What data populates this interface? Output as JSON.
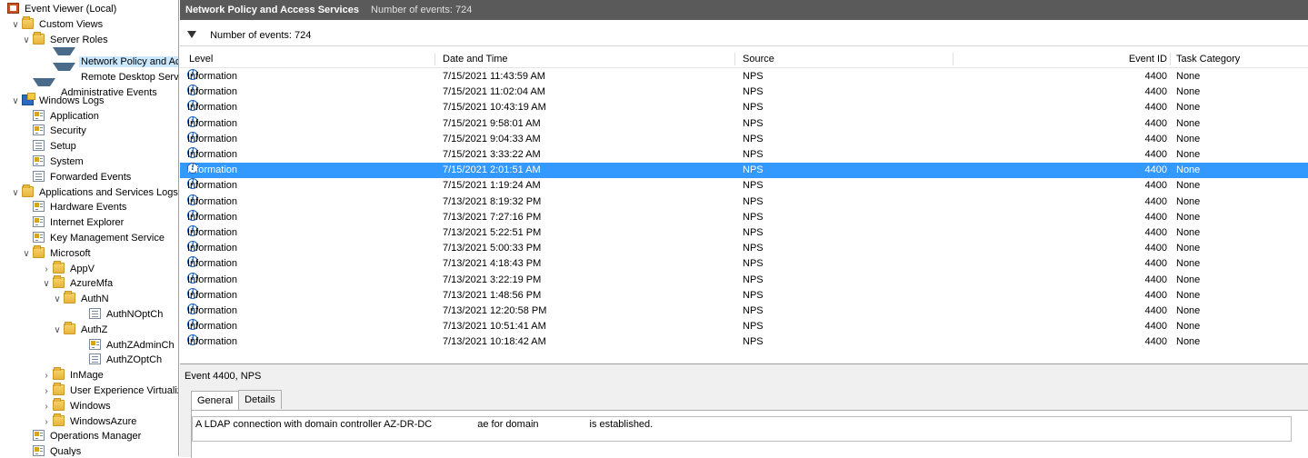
{
  "tree": {
    "items": [
      {
        "label": "Event Viewer (Local)",
        "icon": "event-viewer-icon",
        "level": 0,
        "twist": ""
      },
      {
        "label": "Custom Views",
        "icon": "folder-icon",
        "level": 1,
        "twist": "expanded"
      },
      {
        "label": "Server Roles",
        "icon": "folder-icon",
        "level": 2,
        "twist": "expanded"
      },
      {
        "label": "Network Policy and Access Services",
        "icon": "filter-icon",
        "level": 3,
        "twist": "",
        "selected": true
      },
      {
        "label": "Remote Desktop Services",
        "icon": "filter-icon",
        "level": 3,
        "twist": ""
      },
      {
        "label": "Administrative Events",
        "icon": "filter-icon",
        "level": 2,
        "twist": ""
      },
      {
        "label": "Windows Logs",
        "icon": "windows-logs-icon",
        "level": 1,
        "twist": "expanded"
      },
      {
        "label": "Application",
        "icon": "log-special-icon",
        "level": 2,
        "twist": ""
      },
      {
        "label": "Security",
        "icon": "log-special-icon",
        "level": 2,
        "twist": ""
      },
      {
        "label": "Setup",
        "icon": "log-icon",
        "level": 2,
        "twist": ""
      },
      {
        "label": "System",
        "icon": "log-special-icon",
        "level": 2,
        "twist": ""
      },
      {
        "label": "Forwarded Events",
        "icon": "log-icon",
        "level": 2,
        "twist": ""
      },
      {
        "label": "Applications and Services Logs",
        "icon": "folder-icon",
        "level": 1,
        "twist": "expanded"
      },
      {
        "label": "Hardware Events",
        "icon": "log-special-icon",
        "level": 2,
        "twist": ""
      },
      {
        "label": "Internet Explorer",
        "icon": "log-special-icon",
        "level": 2,
        "twist": ""
      },
      {
        "label": "Key Management Service",
        "icon": "log-special-icon",
        "level": 2,
        "twist": ""
      },
      {
        "label": "Microsoft",
        "icon": "folder-icon",
        "level": 2,
        "twist": "expanded"
      },
      {
        "label": "AppV",
        "icon": "folder-icon",
        "level": 3,
        "twist": "collapsed"
      },
      {
        "label": "AzureMfa",
        "icon": "folder-icon",
        "level": 3,
        "twist": "expanded"
      },
      {
        "label": "AuthN",
        "icon": "folder-icon",
        "level": 4,
        "twist": "expanded"
      },
      {
        "label": "AuthNOptCh",
        "icon": "log-icon",
        "level": 5,
        "twist": ""
      },
      {
        "label": "AuthZ",
        "icon": "folder-icon",
        "level": 4,
        "twist": "expanded"
      },
      {
        "label": "AuthZAdminCh",
        "icon": "log-special-icon",
        "level": 5,
        "twist": ""
      },
      {
        "label": "AuthZOptCh",
        "icon": "log-icon",
        "level": 5,
        "twist": ""
      },
      {
        "label": "InMage",
        "icon": "folder-icon",
        "level": 3,
        "twist": "collapsed"
      },
      {
        "label": "User Experience Virtualization",
        "icon": "folder-icon",
        "level": 3,
        "twist": "collapsed"
      },
      {
        "label": "Windows",
        "icon": "folder-icon",
        "level": 3,
        "twist": "collapsed"
      },
      {
        "label": "WindowsAzure",
        "icon": "folder-icon",
        "level": 3,
        "twist": "collapsed"
      },
      {
        "label": "Operations Manager",
        "icon": "log-special-icon",
        "level": 2,
        "twist": ""
      },
      {
        "label": "Qualys",
        "icon": "log-special-icon",
        "level": 2,
        "twist": ""
      }
    ]
  },
  "header": {
    "title": "Network Policy and Access Services",
    "count_text": "Number of events: 724"
  },
  "filter": {
    "text": "Number of events: 724"
  },
  "table": {
    "columns": {
      "level": "Level",
      "date": "Date and Time",
      "source": "Source",
      "event_id": "Event ID",
      "task": "Task Category"
    },
    "rows": [
      {
        "level": "Information",
        "date": "7/15/2021 11:43:59 AM",
        "source": "NPS",
        "event_id": "4400",
        "task": "None"
      },
      {
        "level": "Information",
        "date": "7/15/2021 11:02:04 AM",
        "source": "NPS",
        "event_id": "4400",
        "task": "None"
      },
      {
        "level": "Information",
        "date": "7/15/2021 10:43:19 AM",
        "source": "NPS",
        "event_id": "4400",
        "task": "None"
      },
      {
        "level": "Information",
        "date": "7/15/2021 9:58:01 AM",
        "source": "NPS",
        "event_id": "4400",
        "task": "None"
      },
      {
        "level": "Information",
        "date": "7/15/2021 9:04:33 AM",
        "source": "NPS",
        "event_id": "4400",
        "task": "None"
      },
      {
        "level": "Information",
        "date": "7/15/2021 3:33:22 AM",
        "source": "NPS",
        "event_id": "4400",
        "task": "None"
      },
      {
        "level": "Information",
        "date": "7/15/2021 2:01:51 AM",
        "source": "NPS",
        "event_id": "4400",
        "task": "None",
        "selected": true
      },
      {
        "level": "Information",
        "date": "7/15/2021 1:19:24 AM",
        "source": "NPS",
        "event_id": "4400",
        "task": "None"
      },
      {
        "level": "Information",
        "date": "7/13/2021 8:19:32 PM",
        "source": "NPS",
        "event_id": "4400",
        "task": "None"
      },
      {
        "level": "Information",
        "date": "7/13/2021 7:27:16 PM",
        "source": "NPS",
        "event_id": "4400",
        "task": "None"
      },
      {
        "level": "Information",
        "date": "7/13/2021 5:22:51 PM",
        "source": "NPS",
        "event_id": "4400",
        "task": "None"
      },
      {
        "level": "Information",
        "date": "7/13/2021 5:00:33 PM",
        "source": "NPS",
        "event_id": "4400",
        "task": "None"
      },
      {
        "level": "Information",
        "date": "7/13/2021 4:18:43 PM",
        "source": "NPS",
        "event_id": "4400",
        "task": "None"
      },
      {
        "level": "Information",
        "date": "7/13/2021 3:22:19 PM",
        "source": "NPS",
        "event_id": "4400",
        "task": "None"
      },
      {
        "level": "Information",
        "date": "7/13/2021 1:48:56 PM",
        "source": "NPS",
        "event_id": "4400",
        "task": "None"
      },
      {
        "level": "Information",
        "date": "7/13/2021 12:20:58 PM",
        "source": "NPS",
        "event_id": "4400",
        "task": "None"
      },
      {
        "level": "Information",
        "date": "7/13/2021 10:51:41 AM",
        "source": "NPS",
        "event_id": "4400",
        "task": "None"
      },
      {
        "level": "Information",
        "date": "7/13/2021 10:18:42 AM",
        "source": "NPS",
        "event_id": "4400",
        "task": "None"
      }
    ]
  },
  "detail": {
    "title": "Event 4400, NPS",
    "tabs": {
      "general": "General",
      "details": "Details"
    },
    "message_part1": "A LDAP connection with domain controller AZ-DR-DC",
    "message_part2": "ae for domain",
    "message_part3": "is established."
  },
  "colors": {
    "title_bar": "#5a5a5a",
    "selection": "#3399ff",
    "tree_selection": "#cce8ff"
  }
}
